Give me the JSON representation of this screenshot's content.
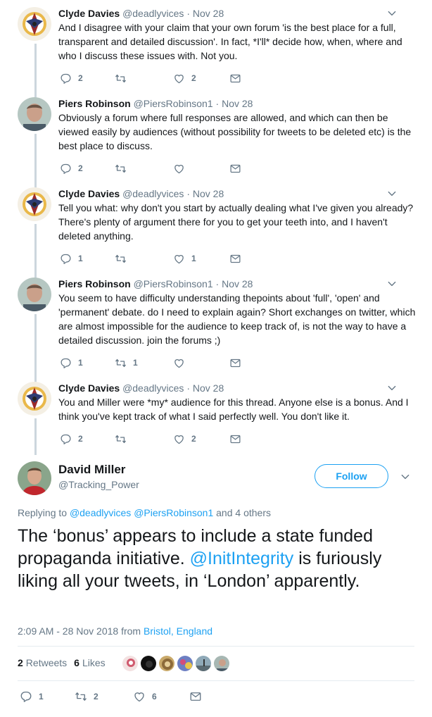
{
  "tweets": [
    {
      "name": "Clyde Davies",
      "handle": "@deadlyvices",
      "sep": "·",
      "time": "Nov 28",
      "text": "And I disagree with your claim that your own forum 'is the best place for a full, transparent and detailed discussion'.  In fact, *I'll* decide how, when, where and who I discuss these issues with.  Not you.",
      "replies": "2",
      "retweets": "",
      "likes": "2"
    },
    {
      "name": "Piers Robinson",
      "handle": "@PiersRobinson1",
      "sep": "·",
      "time": "Nov 28",
      "text": "Obviously a forum where full responses are allowed, and which can then be viewed easily by audiences (without possibility for tweets to be deleted etc) is the best place to discuss.",
      "replies": "2",
      "retweets": "",
      "likes": ""
    },
    {
      "name": "Clyde Davies",
      "handle": "@deadlyvices",
      "sep": "·",
      "time": "Nov 28",
      "text": "Tell you what:  why don't you start by actually dealing what I've given you already?  There's plenty of argument there for you to get your teeth into, and I haven't deleted anything.",
      "replies": "1",
      "retweets": "",
      "likes": "1"
    },
    {
      "name": "Piers Robinson",
      "handle": "@PiersRobinson1",
      "sep": "·",
      "time": "Nov 28",
      "text": "You seem to have difficulty understanding thepoints about 'full', 'open' and 'permanent' debate. do I need to explain again? Short exchanges on twitter, which are almost impossible for the audience to keep track of, is not the way to have a detailed discussion. join the forums ;)",
      "replies": "1",
      "retweets": "1",
      "likes": ""
    },
    {
      "name": "Clyde Davies",
      "handle": "@deadlyvices",
      "sep": "·",
      "time": "Nov 28",
      "text": "You and Miller were *my* audience for this thread.  Anyone else is a bonus.  And I think you've kept track of what I said perfectly well.  You don't like it.",
      "replies": "2",
      "retweets": "",
      "likes": "2"
    }
  ],
  "main": {
    "name": "David Miller",
    "handle": "@Tracking_Power",
    "follow_label": "Follow",
    "replying_prefix": "Replying to",
    "replying_user1": "@deadlyvices",
    "replying_user2": "@PiersRobinson1",
    "replying_suffix": "and 4 others",
    "text_part1": "The ‘bonus’ appears to include a state funded propaganda initiative. ",
    "mention": "@InitIntegrity",
    "text_part2": " is furiously liking all your tweets,  in ‘London’ apparently.",
    "timestamp": "2:09 AM - 28 Nov 2018 from",
    "location": "Bristol, England",
    "retweet_count": "2",
    "retweet_label": "Retweets",
    "like_count": "6",
    "like_label": "Likes",
    "replies": "1",
    "retweets": "2",
    "likes": "6"
  },
  "colors": {
    "accent": "#1da1f2",
    "secondary_text": "#657786",
    "thread_line": "#ccd6dd"
  },
  "icons": [
    "reply-icon",
    "retweet-icon",
    "like-icon",
    "direct-message-icon",
    "chevron-down-icon"
  ]
}
